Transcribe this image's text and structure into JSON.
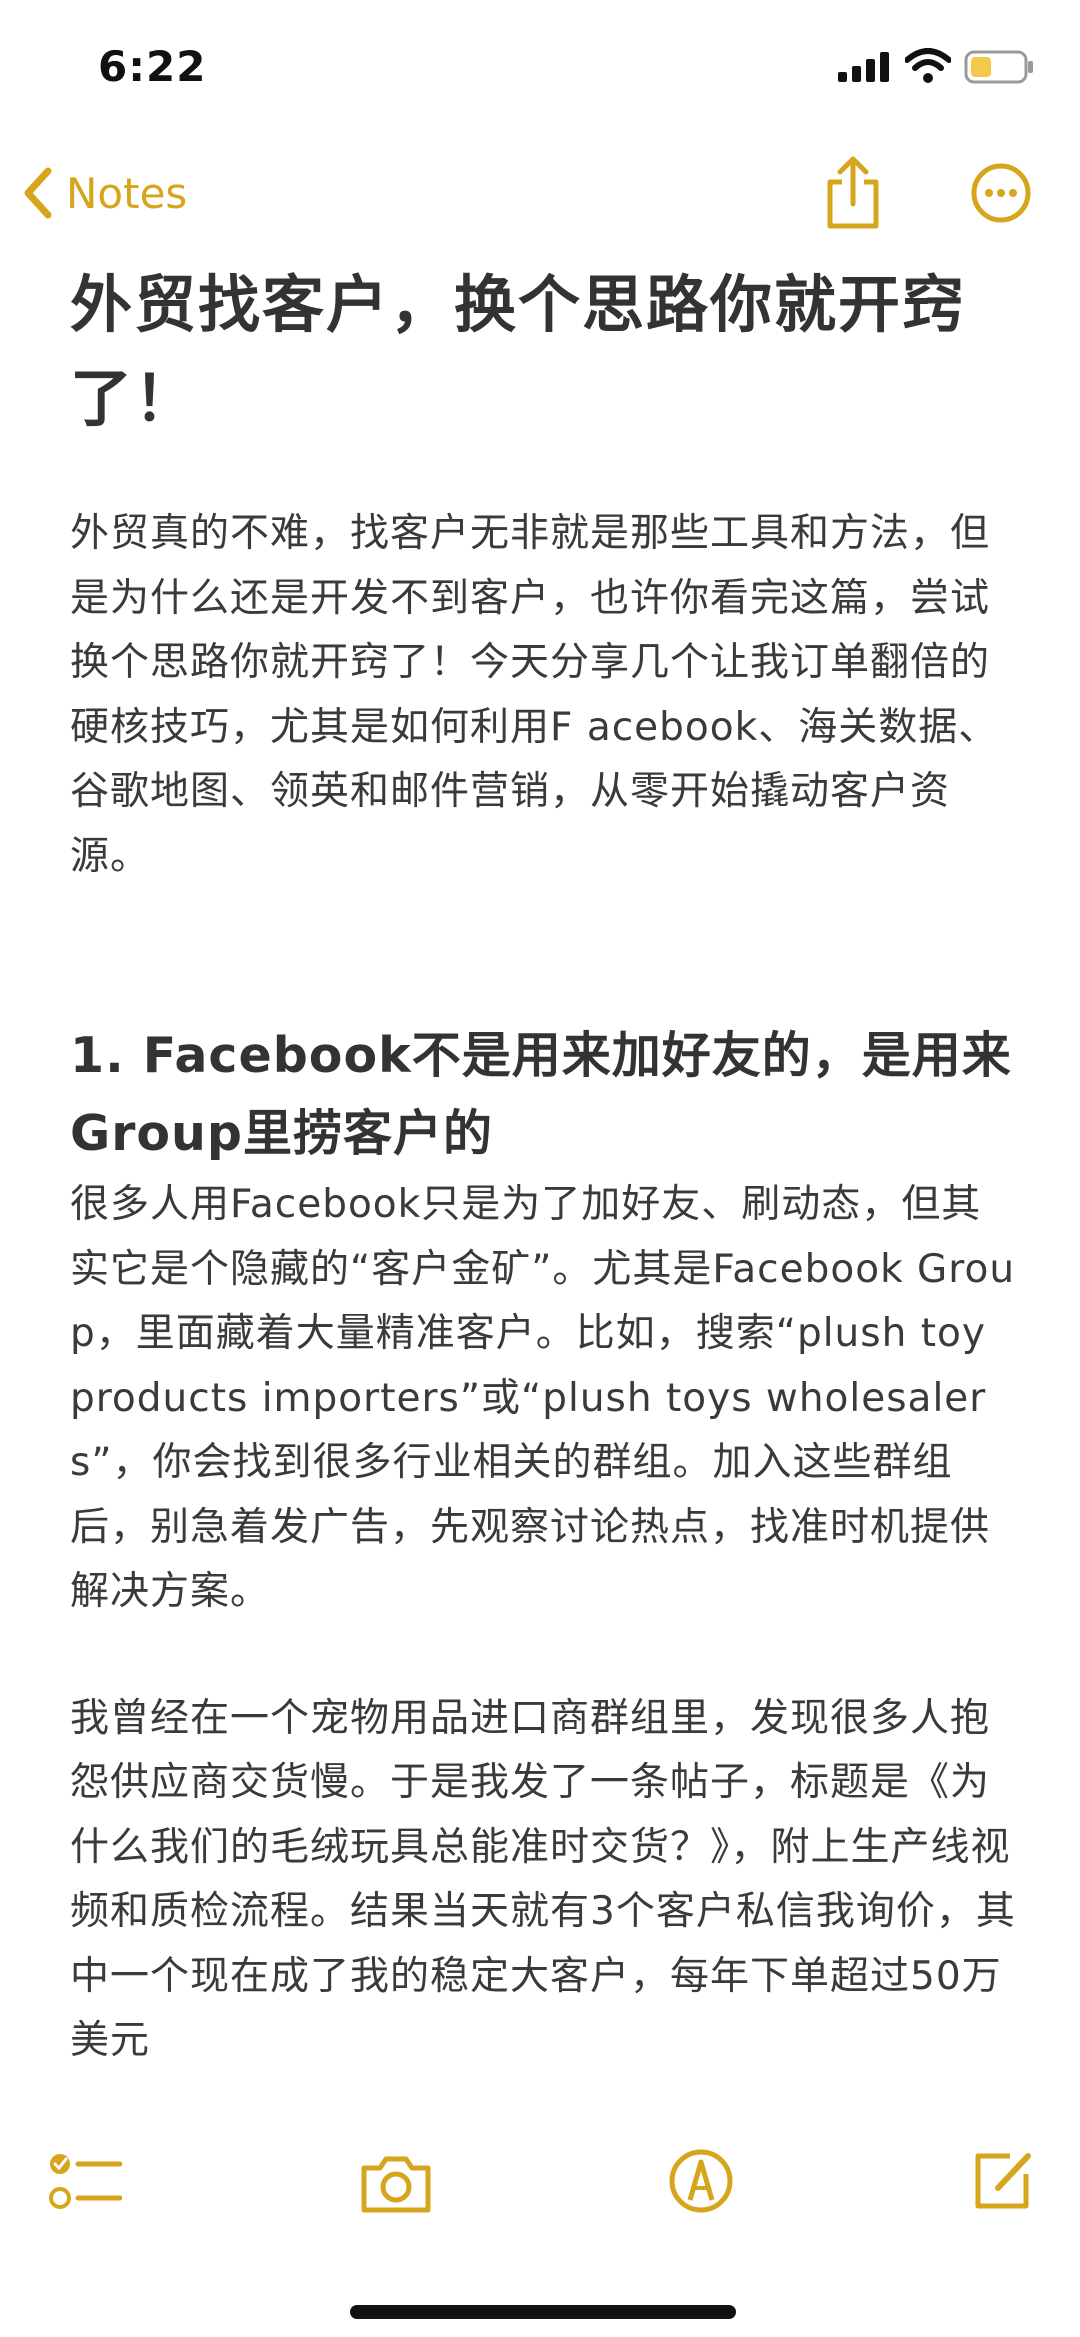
{
  "status_bar": {
    "time": "6:22"
  },
  "nav": {
    "back_label": "Notes",
    "accent_color": "#D6A51C",
    "icons": [
      "chevron-left-icon",
      "share-icon",
      "more-icon"
    ]
  },
  "note": {
    "title": "外贸找客户，换个思路你就开窍了！",
    "intro": "外贸真的不难，找客户无非就是那些工具和方法，但是为什么还是开发不到客户，也许你看完这篇，尝试换个思路你就开窍了！今天分享几个让我订单翻倍的硬核技巧，尤其是如何利用F acebook、海关数据、谷歌地图、领英和邮件营销，从零开始撬动客户资源。",
    "section1_heading": "1. Facebook不是用来加好友的，是用来Group里捞客户的",
    "section1_p1": "很多人用Facebook只是为了加好友、刷动态，但其实它是个隐藏的“客户金矿”。尤其是Facebook Group，里面藏着大量精准客户。比如，搜索“plush toy products importers”或“plush toys wholesalers”，你会找到很多行业相关的群组。加入这些群组后，别急着发广告，先观察讨论热点，找准时机提供解决方案。",
    "section1_p2": "我曾经在一个宠物用品进口商群组里，发现很多人抱怨供应商交货慢。于是我发了一条帖子，标题是《为什么我们的毛绒玩具总能准时交货？》，附上生产线视频和质检流程。结果当天就有3个客户私信我询价，其中一个现在成了我的稳定大客户，每年下单超过50万美元"
  },
  "toolbar": {
    "icons": [
      "checklist-icon",
      "camera-icon",
      "markup-icon",
      "compose-icon"
    ]
  }
}
